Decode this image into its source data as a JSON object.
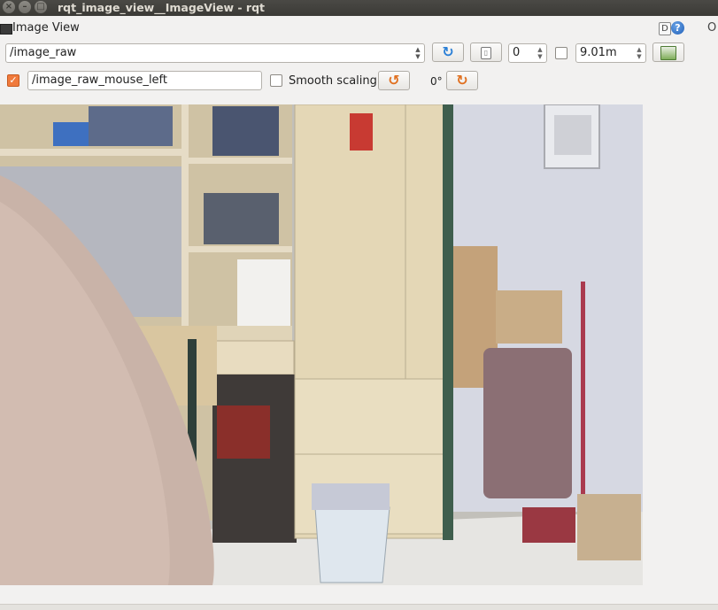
{
  "window": {
    "title": "rqt_image_view__ImageView - rqt"
  },
  "plugin": {
    "title": "Image View",
    "dock_label": "D",
    "help_label": "?",
    "close_label": "O"
  },
  "toolbar": {
    "topic_value": "/image_raw",
    "refresh_icon": "refresh-icon",
    "screenshot_icon": "zoom-reset-icon",
    "zero_value": "0",
    "dynamic_range_checked": false,
    "max_range_value": "9.01m",
    "save_icon": "save-image-icon"
  },
  "mouse": {
    "publish_checked": true,
    "topic_value": "/image_raw_mouse_left"
  },
  "view": {
    "smooth_scaling_label": "Smooth scaling",
    "smooth_scaling_checked": false,
    "rotation_label": "0°",
    "rotate_left_icon": "rotate-left-icon",
    "rotate_right_icon": "rotate-right-icon"
  },
  "colors": {
    "accent": "#f07a3c",
    "refresh_blue": "#2a7fd6",
    "rotate_orange": "#e07020"
  }
}
